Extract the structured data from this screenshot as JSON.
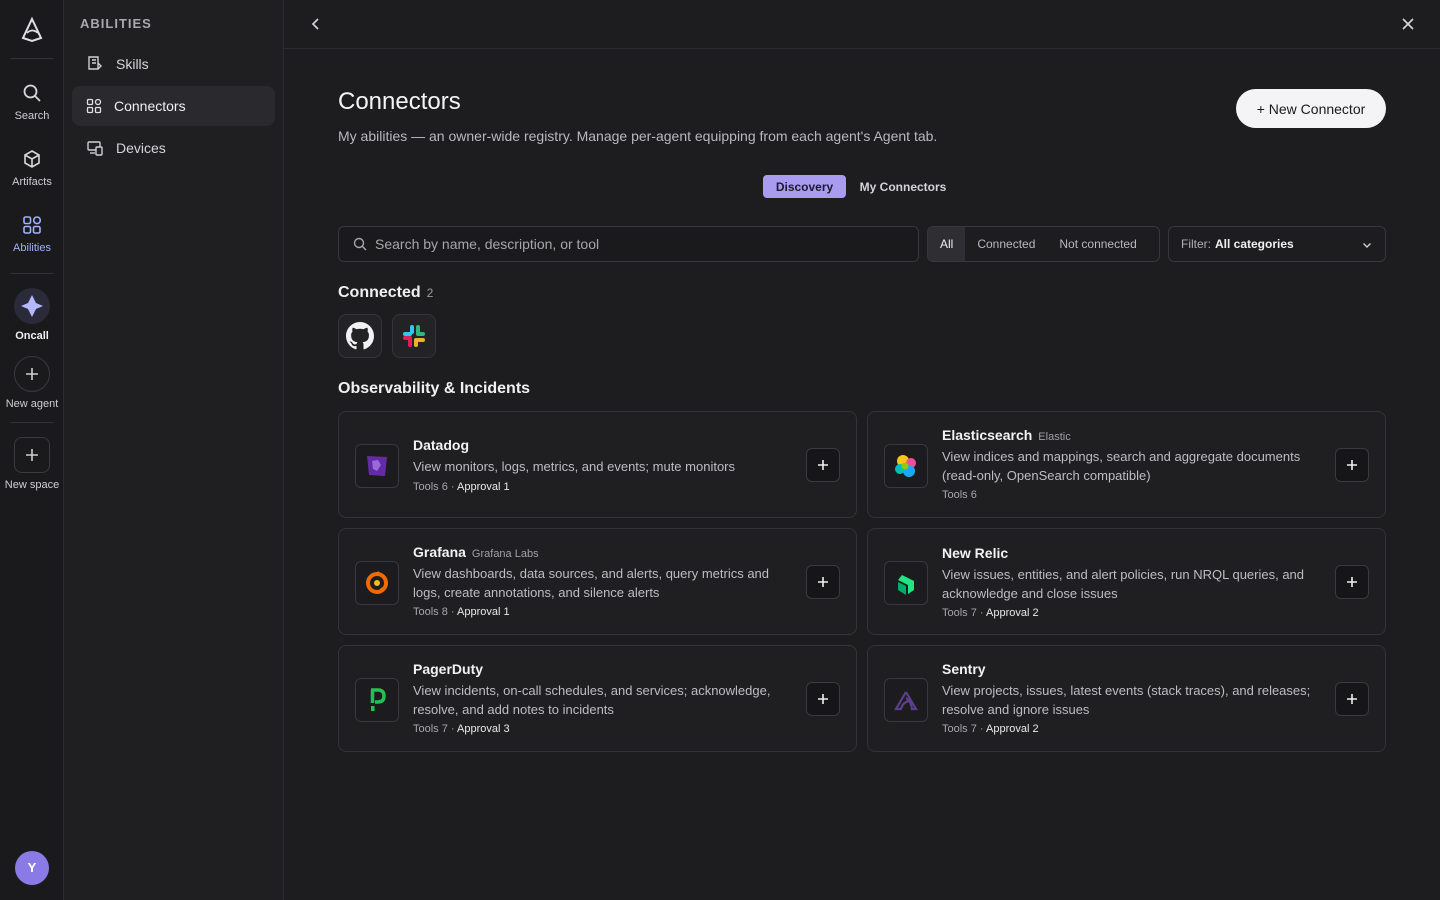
{
  "rail": {
    "items": [
      {
        "label": "Search",
        "icon": "search-icon"
      },
      {
        "label": "Artifacts",
        "icon": "cube-icon"
      },
      {
        "label": "Abilities",
        "icon": "grid-icon"
      },
      {
        "label": "Oncall",
        "icon": "agent-icon"
      },
      {
        "label": "New agent",
        "icon": "plus-icon"
      },
      {
        "label": "New space",
        "icon": "plus-icon"
      }
    ],
    "avatar": "Y"
  },
  "sidebar": {
    "title": "ABILITIES",
    "items": [
      {
        "label": "Skills"
      },
      {
        "label": "Connectors"
      },
      {
        "label": "Devices"
      }
    ]
  },
  "page": {
    "title": "Connectors",
    "subtitle": "My abilities — an owner-wide registry. Manage per-agent equipping from each agent's Agent tab.",
    "new_button": "+ New Connector",
    "view_tabs": [
      "Discovery",
      "My Connectors"
    ],
    "search_placeholder": "Search by name, description, or tool",
    "status_tabs": [
      "All",
      "Connected",
      "Not connected"
    ],
    "filter_key": "Filter:",
    "filter_value": "All categories"
  },
  "connected": {
    "title": "Connected",
    "count": "2",
    "icons": [
      "github-icon",
      "slack-icon"
    ]
  },
  "category": {
    "title": "Observability & Incidents",
    "cards": [
      {
        "name": "Datadog",
        "vendor": "",
        "desc": "View monitors, logs, metrics, and events; mute monitors",
        "tools": "Tools 6 · ",
        "approval": "Approval 1",
        "icon": "datadog-icon"
      },
      {
        "name": "Elasticsearch",
        "vendor": "Elastic",
        "desc": "View indices and mappings, search and aggregate documents (read-only, OpenSearch compatible)",
        "tools": "Tools 6",
        "approval": "",
        "icon": "elasticsearch-icon"
      },
      {
        "name": "Grafana",
        "vendor": "Grafana Labs",
        "desc": "View dashboards, data sources, and alerts, query metrics and logs, create annotations, and silence alerts",
        "tools": "Tools 8 · ",
        "approval": "Approval 1",
        "icon": "grafana-icon"
      },
      {
        "name": "New Relic",
        "vendor": "",
        "desc": "View issues, entities, and alert policies, run NRQL queries, and acknowledge and close issues",
        "tools": "Tools 7 · ",
        "approval": "Approval 2",
        "icon": "newrelic-icon"
      },
      {
        "name": "PagerDuty",
        "vendor": "",
        "desc": "View incidents, on-call schedules, and services; acknowledge, resolve, and add notes to incidents",
        "tools": "Tools 7 · ",
        "approval": "Approval 3",
        "icon": "pagerduty-icon"
      },
      {
        "name": "Sentry",
        "vendor": "",
        "desc": "View projects, issues, latest events (stack traces), and releases; resolve and ignore issues",
        "tools": "Tools 7 · ",
        "approval": "Approval 2",
        "icon": "sentry-icon"
      }
    ]
  },
  "colors": {
    "accent": "#a99cf0",
    "background": "#1d1d20"
  }
}
